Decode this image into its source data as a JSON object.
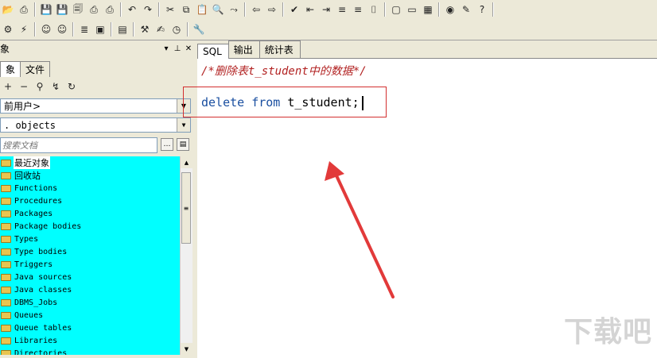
{
  "toolbar1": {
    "buttons": [
      {
        "name": "open-icon",
        "glyph": "📂"
      },
      {
        "name": "print-icon",
        "glyph": "⎙"
      },
      {
        "name": "save-icon",
        "glyph": "💾"
      },
      {
        "name": "save-as-icon",
        "glyph": "💾"
      },
      {
        "name": "save-all-icon",
        "glyph": "🗐"
      },
      {
        "name": "print-setup-icon",
        "glyph": "⎙"
      },
      {
        "name": "page-setup-icon",
        "glyph": "⎙"
      },
      {
        "name": "undo-icon",
        "glyph": "↶"
      },
      {
        "name": "redo-icon",
        "glyph": "↷"
      },
      {
        "name": "cut-icon",
        "glyph": "✂"
      },
      {
        "name": "copy-icon",
        "glyph": "⧉"
      },
      {
        "name": "paste-icon",
        "glyph": "📋"
      },
      {
        "name": "find-icon",
        "glyph": "🔍"
      },
      {
        "name": "find-next-icon",
        "glyph": "⤳"
      },
      {
        "name": "back-icon",
        "glyph": "⇦"
      },
      {
        "name": "forward-icon",
        "glyph": "⇨"
      },
      {
        "name": "check-icon",
        "glyph": "✔"
      },
      {
        "name": "indent-icon",
        "glyph": "⇤"
      },
      {
        "name": "unindent-icon",
        "glyph": "⇥"
      },
      {
        "name": "comment-icon",
        "glyph": "≡"
      },
      {
        "name": "uncomment-icon",
        "glyph": "≡"
      },
      {
        "name": "bookmark-icon",
        "glyph": "⌷"
      },
      {
        "name": "window-icon",
        "glyph": "▢"
      },
      {
        "name": "cascade-icon",
        "glyph": "▭"
      },
      {
        "name": "tile-icon",
        "glyph": "▦"
      },
      {
        "name": "oracle-icon",
        "glyph": "◉"
      },
      {
        "name": "pdf-icon",
        "glyph": "✎"
      },
      {
        "name": "help-icon",
        "glyph": "?"
      }
    ]
  },
  "toolbar2": {
    "buttons": [
      {
        "name": "gear-icon",
        "glyph": "⚙"
      },
      {
        "name": "wand-icon",
        "glyph": "⚡"
      },
      {
        "name": "user-icon",
        "glyph": "☺"
      },
      {
        "name": "user2-icon",
        "glyph": "☺"
      },
      {
        "name": "sql-window-icon",
        "glyph": "≣"
      },
      {
        "name": "command-window-icon",
        "glyph": "▣"
      },
      {
        "name": "report-icon",
        "glyph": "▤"
      },
      {
        "name": "tools-icon",
        "glyph": "⚒"
      },
      {
        "name": "notes-icon",
        "glyph": "✍"
      },
      {
        "name": "clock-icon",
        "glyph": "◷"
      },
      {
        "name": "wrench-icon",
        "glyph": "🔧"
      }
    ]
  },
  "left_panel": {
    "title": "象",
    "tabs": [
      "象",
      "文件"
    ],
    "user_combo": "前用户>",
    "type_combo": ". objects",
    "search_placeholder": "搜索文档",
    "tree_items": [
      "最近对象",
      "回收站",
      "Functions",
      "Procedures",
      "Packages",
      "Package bodies",
      "Types",
      "Type bodies",
      "Triggers",
      "Java sources",
      "Java classes",
      "DBMS_Jobs",
      "Queues",
      "Queue tables",
      "Libraries",
      "Directories"
    ]
  },
  "editor": {
    "tabs": [
      "SQL",
      "输出",
      "统计表"
    ],
    "comment": "/*删除表t_student中的数据*/",
    "code_keyword1": "delete",
    "code_keyword2": "from",
    "code_table": "t_student;"
  },
  "watermark": "下载吧",
  "colors": {
    "tree_bg": "#00ffff",
    "highlight": "#d32f2f",
    "keyword": "#1a4fa0",
    "comment": "#b22222"
  }
}
